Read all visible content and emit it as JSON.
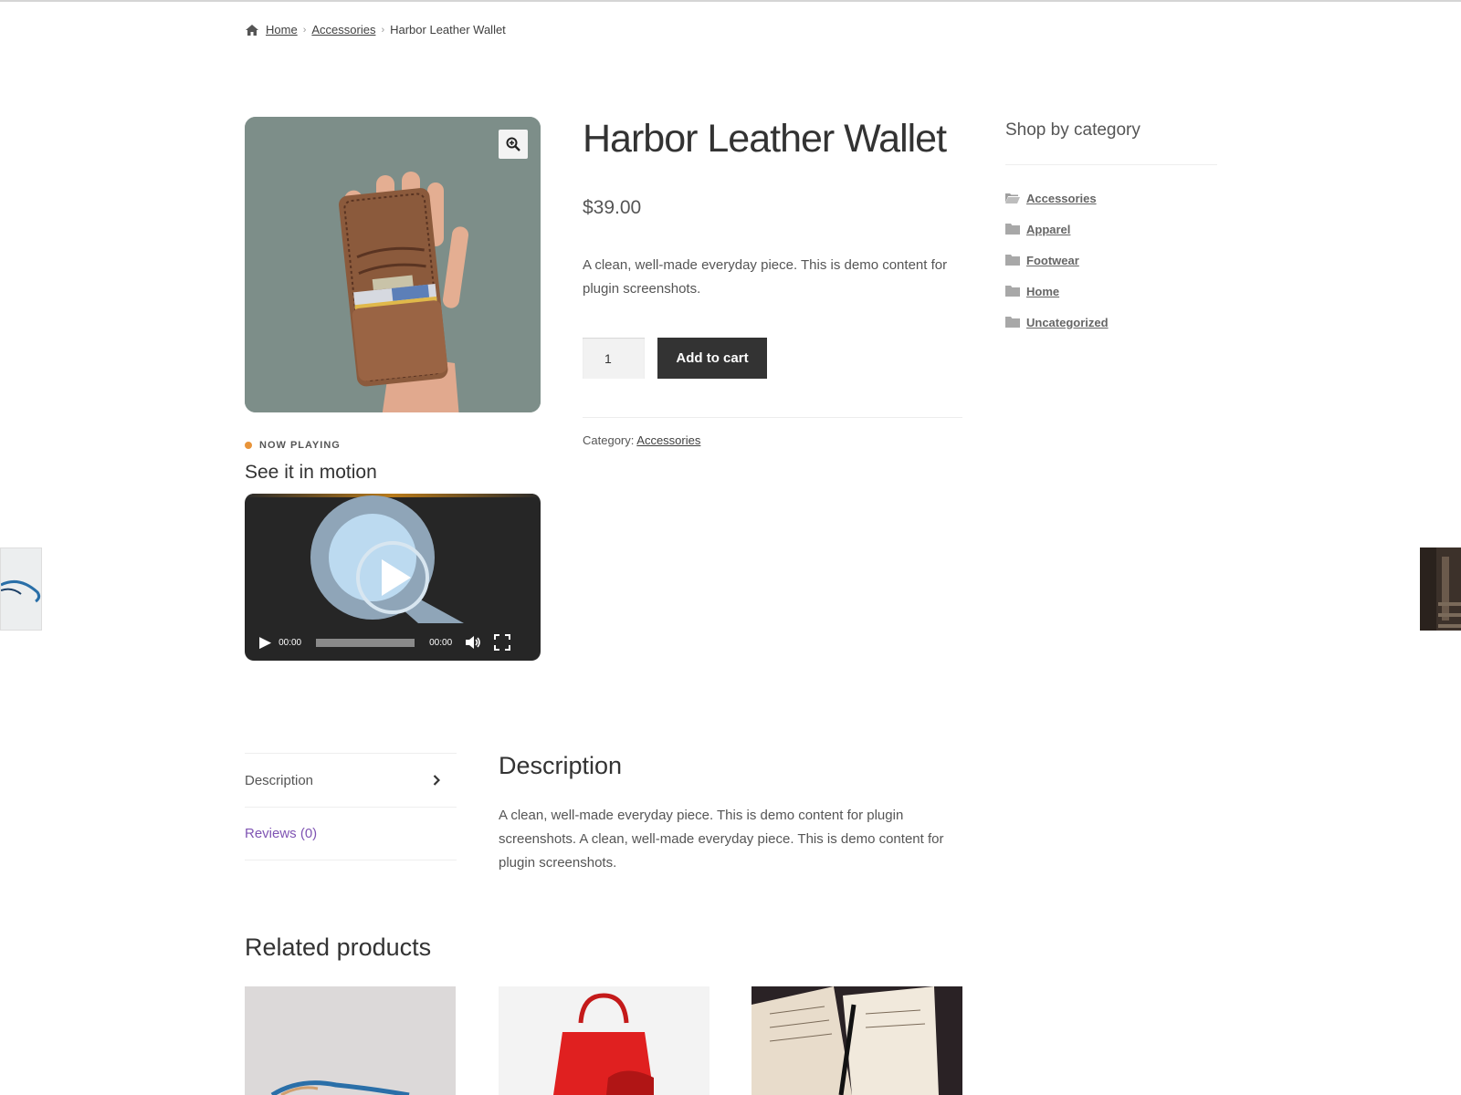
{
  "breadcrumb": {
    "home": "Home",
    "category": "Accessories",
    "current": "Harbor Leather Wallet"
  },
  "product": {
    "title": "Harbor Leather Wallet",
    "price": "$39.00",
    "short_description": "A clean, well-made everyday piece. This is demo content for plugin screenshots.",
    "quantity": "1",
    "add_to_cart_label": "Add to cart",
    "category_label": "Category:",
    "category_value": "Accessories"
  },
  "video": {
    "badge": "NOW PLAYING",
    "title": "See it in motion",
    "current_time": "00:00",
    "duration": "00:00"
  },
  "sidebar": {
    "title": "Shop by category",
    "categories": [
      "Accessories",
      "Apparel",
      "Footwear",
      "Home",
      "Uncategorized"
    ]
  },
  "tabs": {
    "items": [
      "Description",
      "Reviews (0)"
    ],
    "active": "Description"
  },
  "description": {
    "heading": "Description",
    "body": "A clean, well-made everyday piece. This is demo content for plugin screenshots. A clean, well-made everyday piece. This is demo content for plugin screenshots."
  },
  "related": {
    "title": "Related products"
  },
  "colors": {
    "button": "#333333",
    "accent_link": "#7f54b3",
    "badge_dot": "#e8943a"
  }
}
